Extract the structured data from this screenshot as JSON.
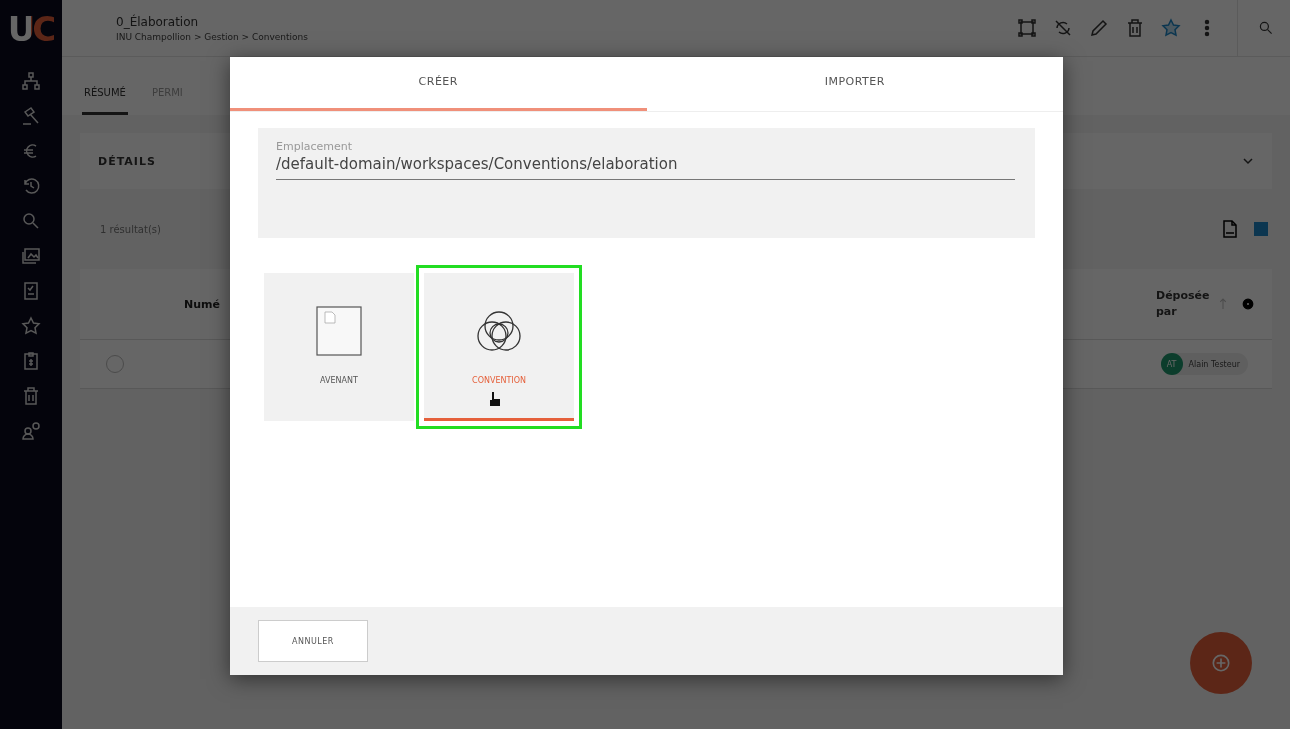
{
  "sidebar": {
    "logo": "UC"
  },
  "header": {
    "title": "0_Élaboration",
    "breadcrumb": "INU Champollion > Gestion > Conventions",
    "favorite": true
  },
  "tabs": [
    {
      "label": "RÉSUMÉ",
      "selected": true
    },
    {
      "label": "PERMI",
      "selected": false
    }
  ],
  "details": {
    "title": "DÉTAILS",
    "expanded": false
  },
  "results": {
    "count": "1 résultat(s)"
  },
  "table": {
    "columns": [
      "Numé",
      "Déposée par"
    ],
    "rows": [
      {
        "selected": false,
        "initials": "AT",
        "depositor": "Alain Testeur"
      }
    ]
  },
  "dialog": {
    "tabs": [
      {
        "label": "CRÉER",
        "selected": true
      },
      {
        "label": "IMPORTER",
        "selected": false
      }
    ],
    "location": {
      "label": "Emplacement",
      "value": "/default-domain/workspaces/Conventions/elaboration"
    },
    "types": [
      {
        "label": "AVENANT",
        "kind": "document",
        "selected": false
      },
      {
        "label": "CONVENTION",
        "kind": "rings",
        "selected": true
      }
    ],
    "cancel": "ANNULER"
  }
}
